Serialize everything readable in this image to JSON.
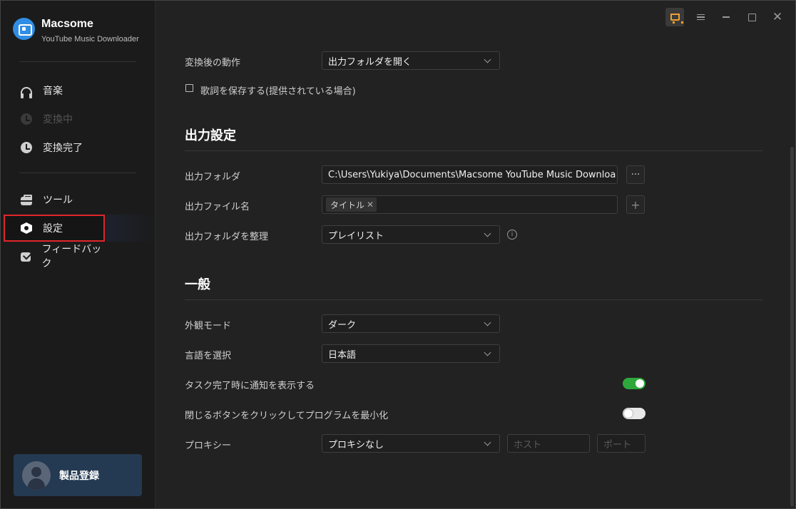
{
  "brand": {
    "name": "Macsome",
    "subtitle": "YouTube Music Downloader"
  },
  "sidebar": {
    "items": [
      {
        "label": "音楽",
        "icon": "headphones-icon"
      },
      {
        "label": "変換中",
        "icon": "converting-icon"
      },
      {
        "label": "変換完了",
        "icon": "clock-icon"
      },
      {
        "label": "ツール",
        "icon": "toolbox-icon"
      },
      {
        "label": "設定",
        "icon": "settings-hex-icon"
      },
      {
        "label": "フィードバック",
        "icon": "mail-icon"
      }
    ],
    "register_label": "製品登録"
  },
  "settings": {
    "after_convert": {
      "label": "変換後の動作",
      "value": "出力フォルダを開く"
    },
    "save_lyrics": {
      "label": "歌詞を保存する(提供されている場合)",
      "checked": false
    },
    "output": {
      "title": "出力設定",
      "folder": {
        "label": "出力フォルダ",
        "value": "C:\\Users\\Yukiya\\Documents\\Macsome YouTube Music Downloa",
        "browse_label": "···"
      },
      "filename": {
        "label": "出力ファイル名",
        "tag": "タイトル",
        "add_label": "+"
      },
      "organize": {
        "label": "出力フォルダを整理",
        "value": "プレイリスト",
        "info_label": "i"
      }
    },
    "general": {
      "title": "一般",
      "appearance": {
        "label": "外観モード",
        "value": "ダーク"
      },
      "language": {
        "label": "言語を選択",
        "value": "日本語"
      },
      "notify": {
        "label": "タスク完了時に通知を表示する",
        "on": true
      },
      "minimize": {
        "label": "閉じるボタンをクリックしてプログラムを最小化",
        "on": false
      },
      "proxy": {
        "label": "プロキシー",
        "value": "プロキシなし",
        "host_placeholder": "ホスト",
        "port_placeholder": "ポート"
      }
    }
  },
  "colors": {
    "accent_green": "#2ea83a",
    "highlight_red": "#e0262a",
    "cart_orange": "#f0a030"
  }
}
